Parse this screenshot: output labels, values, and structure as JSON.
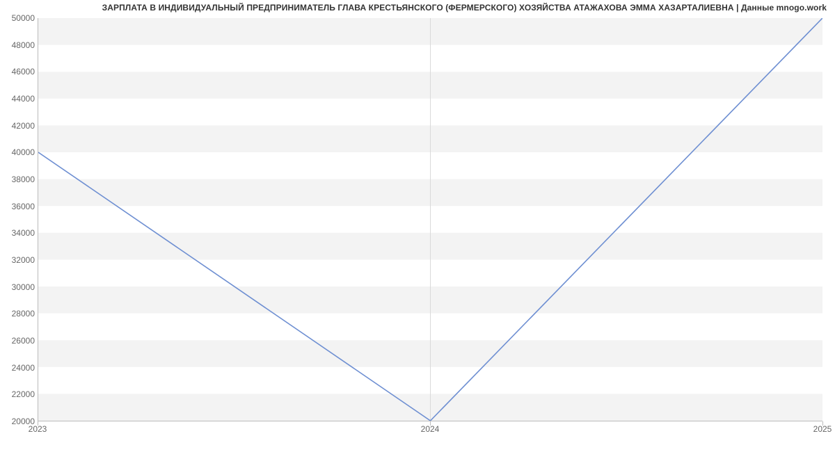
{
  "chart_data": {
    "type": "line",
    "title": "ЗАРПЛАТА В ИНДИВИДУАЛЬНЫЙ ПРЕДПРИНИМАТЕЛЬ ГЛАВА КРЕСТЬЯНСКОГО (ФЕРМЕРСКОГО) ХОЗЯЙСТВА АТАЖАХОВА ЭММА ХАЗАРТАЛИЕВНА | Данные mnogo.work",
    "x": [
      2023,
      2024,
      2025
    ],
    "values": [
      40000,
      20000,
      50000
    ],
    "x_ticks": [
      2023,
      2024,
      2025
    ],
    "y_ticks": [
      20000,
      22000,
      24000,
      26000,
      28000,
      30000,
      32000,
      34000,
      36000,
      38000,
      40000,
      42000,
      44000,
      46000,
      48000,
      50000
    ],
    "ylim": [
      20000,
      50000
    ],
    "xlabel": "",
    "ylabel": "",
    "grid": "horizontal-bands",
    "line_color": "#6e8fd2",
    "band_color": "#f3f3f3"
  }
}
